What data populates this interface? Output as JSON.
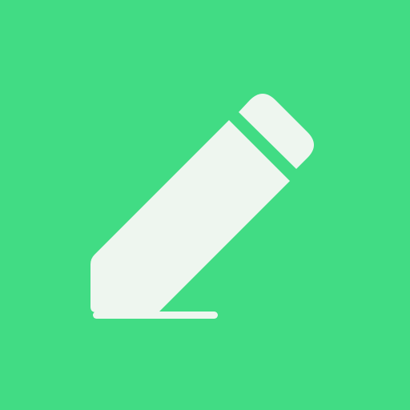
{
  "app_icon": {
    "icon": "pencil-icon",
    "colors": {
      "background": "#41DC84",
      "pencil": "#EEF6EF"
    }
  }
}
